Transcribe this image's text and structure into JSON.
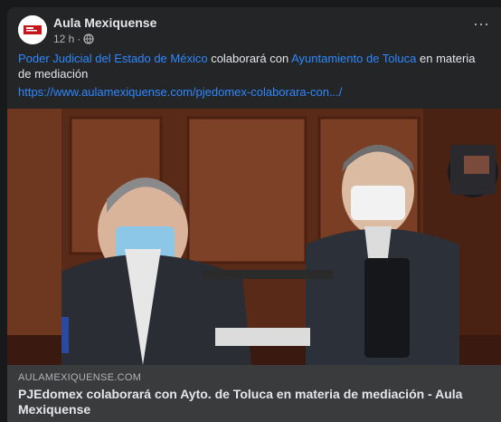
{
  "post": {
    "author": "Aula Mexiquense",
    "time": "12 h",
    "separator": "·",
    "text_part1": "Poder Judicial del Estado de México",
    "text_part2": "colaborará con",
    "text_part3": "Ayuntamiento de Toluca",
    "text_part4": "en materia de mediación",
    "url": "https://www.aulamexiquense.com/pjedomex-colaborara-con.../",
    "more_icon": "⋯"
  },
  "link_preview": {
    "domain": "AULAMEXIQUENSE.COM",
    "title": "PJEdomex colaborará con Ayto. de Toluca en materia de mediación - Aula Mexiquense"
  },
  "colors": {
    "background": "#18191a",
    "card": "#242526",
    "link": "#2d88ff",
    "text": "#e4e6eb",
    "secondary": "#b0b3b8"
  }
}
